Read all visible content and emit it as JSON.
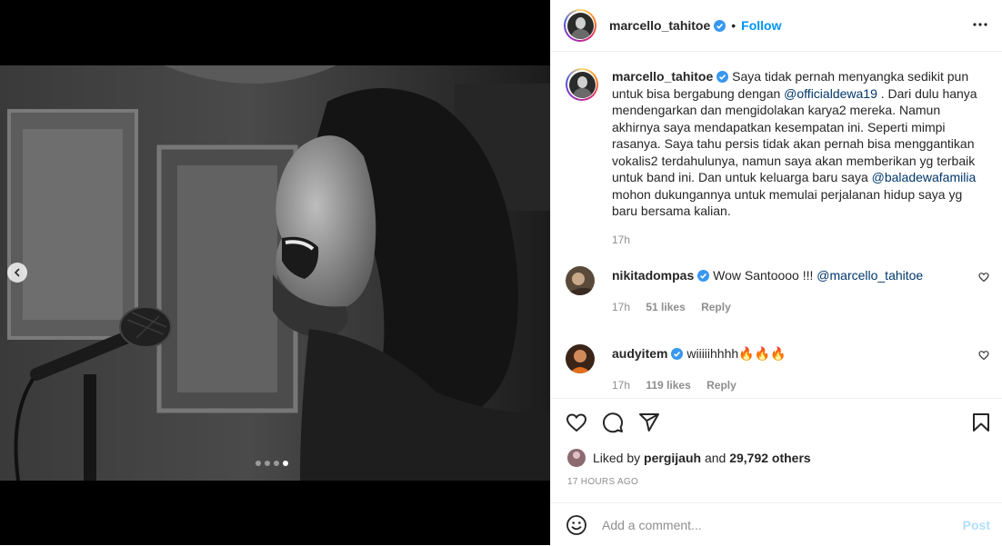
{
  "colors": {
    "accent": "#0095f6",
    "mention": "#00376b",
    "muted": "#8e8e8e",
    "text": "#262626",
    "post_disabled": "#b2dffc"
  },
  "media": {
    "carousel": {
      "total": 4,
      "active_index": 3
    },
    "prev_icon": "chevron-left-icon"
  },
  "header": {
    "username": "marcello_tahitoe",
    "follow_label": "Follow",
    "more_icon": "more-horizontal-icon"
  },
  "caption": {
    "username": "marcello_tahitoe",
    "text_1": "Saya tidak pernah menyangka sedikit pun untuk bisa bergabung dengan ",
    "mention_1": "@officialdewa19",
    "text_2": " . Dari dulu hanya mendengarkan dan mengidolakan karya2 mereka. Namun akhirnya saya mendapatkan kesempatan ini. Seperti mimpi rasanya. Saya tahu persis tidak akan pernah bisa menggantikan vokalis2 terdahulunya, namun saya akan memberikan yg terbaik untuk band ini. Dan untuk keluarga baru saya ",
    "mention_2": "@baladewafamilia",
    "text_3": " mohon dukungannya untuk memulai perjalanan hidup saya yg baru bersama kalian.",
    "time": "17h"
  },
  "comments": [
    {
      "username": "nikitadompas",
      "text": "Wow Santoooo !!! ",
      "mention": "@marcello_tahitoe",
      "time": "17h",
      "likes": "51 likes",
      "reply": "Reply"
    },
    {
      "username": "audyitem",
      "text": "wiiiiihhhh🔥🔥🔥",
      "time": "17h",
      "likes": "119 likes",
      "reply": "Reply"
    }
  ],
  "actions": {
    "liked_prefix": "Liked by ",
    "liked_user": "pergijauh",
    "liked_and": " and ",
    "liked_others": "29,792 others",
    "time_ago": "17 HOURS AGO"
  },
  "add_comment": {
    "placeholder": "Add a comment...",
    "post_label": "Post"
  }
}
